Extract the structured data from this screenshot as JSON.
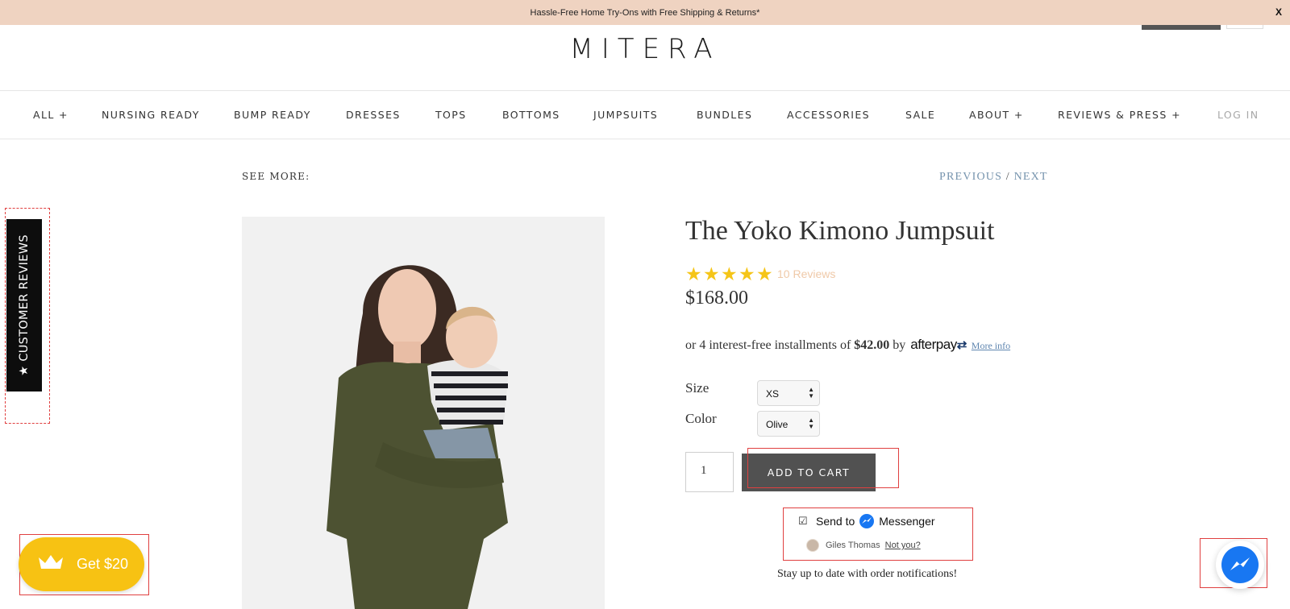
{
  "announcement": {
    "text": "Hassle-Free Home Try-Ons with Free Shipping & Returns*",
    "close_label": "X"
  },
  "header": {
    "logo": "MITERA"
  },
  "nav": {
    "items": [
      {
        "label": "ALL +"
      },
      {
        "label": "NURSING READY"
      },
      {
        "label": "BUMP READY"
      },
      {
        "label": "DRESSES"
      },
      {
        "label": "TOPS"
      },
      {
        "label": "BOTTOMS"
      },
      {
        "label": "JUMPSUITS"
      },
      {
        "label": "BUNDLES"
      },
      {
        "label": "ACCESSORIES"
      },
      {
        "label": "SALE"
      },
      {
        "label": "ABOUT +"
      },
      {
        "label": "REVIEWS & PRESS +"
      },
      {
        "label": "LOG IN"
      }
    ]
  },
  "pager": {
    "see_more": "SEE MORE:",
    "previous": "PREVIOUS",
    "separator": "/",
    "next": "NEXT"
  },
  "product": {
    "title": "The Yoko Kimono Jumpsuit",
    "rating": 5,
    "reviews_label": "10 Reviews",
    "price": "$168.00",
    "afterpay": {
      "prefix": "or 4 interest-free installments of",
      "amount": "$42.00",
      "by": "by",
      "brand": "afterpay",
      "more_info": "More info"
    },
    "options": {
      "size_label": "Size",
      "size_value": "XS",
      "color_label": "Color",
      "color_value": "Olive"
    },
    "quantity": "1",
    "add_to_cart": "ADD TO CART"
  },
  "messenger_widget": {
    "send_to": "Send to",
    "messenger": "Messenger",
    "user_name": "Giles Thomas",
    "not_you": "Not you?",
    "stay_updated": "Stay up to date with order notifications!"
  },
  "reviews_tab": {
    "label": "★ CUSTOMER REVIEWS"
  },
  "rewards": {
    "label": "Get $20"
  },
  "colors": {
    "announcement_bg": "#efd3c1",
    "accent_link": "#7593ad",
    "star": "#f5c518",
    "rewards_yellow": "#f7c213",
    "messenger_blue": "#1877f2",
    "cart_button": "#515151"
  },
  "icons": [
    "check-icon",
    "messenger-icon",
    "crown-icon",
    "star-icon",
    "dropdown-caret-icon",
    "afterpay-logo"
  ]
}
